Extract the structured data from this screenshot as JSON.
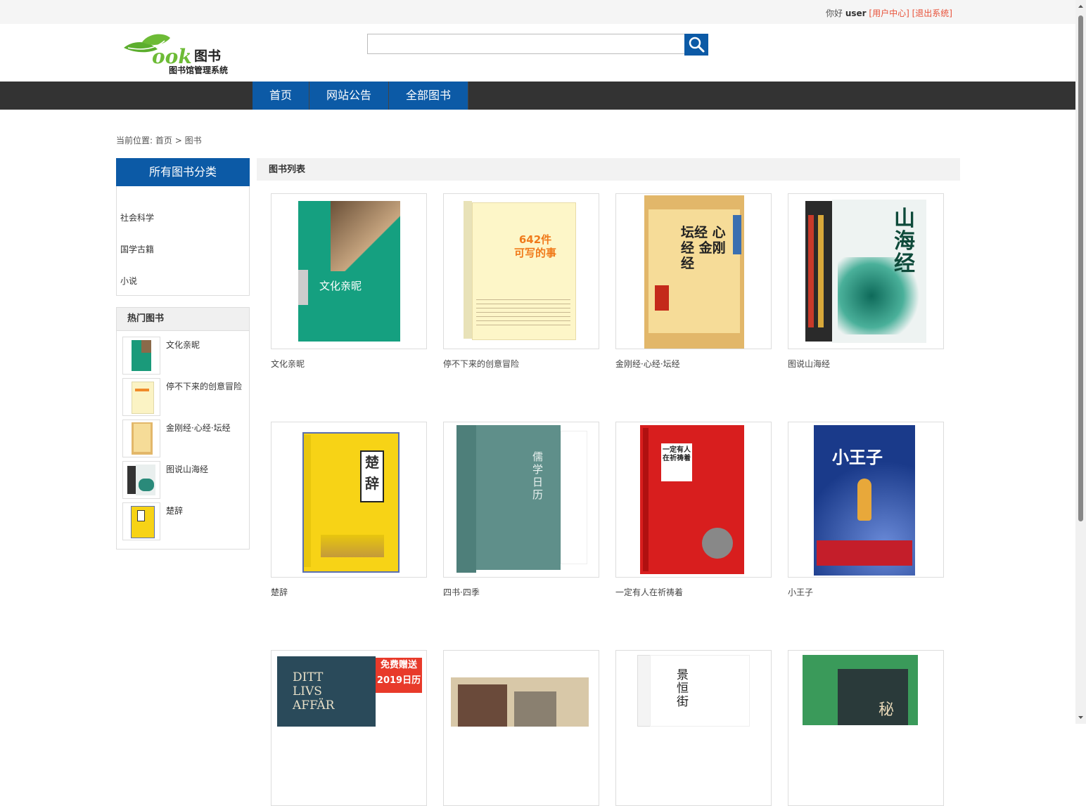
{
  "topbar": {
    "greeting": "你好",
    "username": "user",
    "user_center": "[用户中心]",
    "logout": "[退出系统]"
  },
  "logo": {
    "mark": "ook",
    "brand": "图书",
    "subtitle": "图书馆管理系统"
  },
  "search": {
    "value": "",
    "placeholder": ""
  },
  "nav": {
    "items": [
      "首页",
      "网站公告",
      "全部图书"
    ]
  },
  "breadcrumb": {
    "prefix": "当前位置:",
    "home": "首页",
    "sep": ">",
    "current": "图书"
  },
  "sidebar": {
    "title": "所有图书分类",
    "categories": [
      "社会科学",
      "国学古籍",
      "小说"
    ],
    "hot_title": "热门图书",
    "hot": [
      "文化亲昵",
      "停不下来的创意冒险",
      "金刚经·心经·坛经",
      "图说山海经",
      "楚辞"
    ]
  },
  "list": {
    "title": "图书列表",
    "books": [
      {
        "title": "文化亲昵",
        "cover_text": "文化亲昵"
      },
      {
        "title": "停不下来的创意冒险",
        "cover_text": "642件\n可写的事"
      },
      {
        "title": "金刚经·心经·坛经",
        "cover_text": "坛经 心经 金刚经"
      },
      {
        "title": "图说山海经",
        "cover_text": "山海经"
      },
      {
        "title": "楚辞",
        "cover_text": "楚辞"
      },
      {
        "title": "四书·四季",
        "cover_text": "儒学日历"
      },
      {
        "title": "一定有人在祈祷着",
        "cover_text": "一定有人在祈祷着"
      },
      {
        "title": "小王子",
        "cover_text": "小王子"
      },
      {
        "title": "",
        "cover_text": "DITT LIVS AFFÄR",
        "badge": "免费赠送\n2019日历"
      },
      {
        "title": "",
        "cover_text": ""
      },
      {
        "title": "",
        "cover_text": "景恒街"
      },
      {
        "title": "",
        "cover_text": "秘"
      }
    ]
  },
  "colors": {
    "brand_blue": "#0c5aa6",
    "nav_dark": "#333333",
    "link_red": "#e8523a"
  },
  "icons": {
    "search": "search-icon"
  }
}
